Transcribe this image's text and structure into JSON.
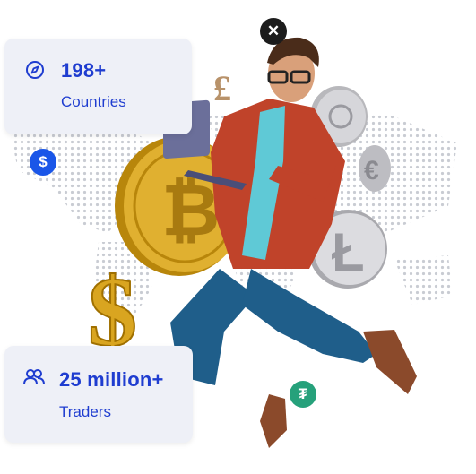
{
  "stats": {
    "countries": {
      "value": "198+",
      "label": "Countries",
      "icon": "compass-icon"
    },
    "traders": {
      "value": "25 million+",
      "label": "Traders",
      "icon": "users-icon"
    }
  },
  "badges": {
    "dollar": {
      "icon": "dollar-icon",
      "glyph": "$",
      "color": "#1a56e8"
    },
    "close": {
      "icon": "close-icon",
      "glyph": "✕",
      "color": "#1c1c1c"
    },
    "tether": {
      "icon": "tether-icon",
      "glyph": "₮",
      "color": "#26a17b"
    }
  },
  "colors": {
    "accent": "#1f3dd0",
    "card_bg": "#eef0f7",
    "shirt": "#c0432a",
    "jeans": "#1f5e8a",
    "gold": "#d9a520",
    "silver": "#c8c8cc"
  }
}
